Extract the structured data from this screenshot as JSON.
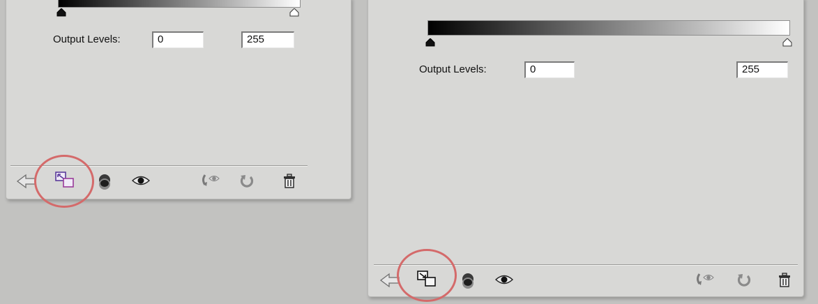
{
  "colors": {
    "background": "#c2c2c0",
    "panel": "#d8d8d6",
    "highlight": "#d46a6a",
    "accent_purple": "#6a3fa8"
  },
  "left_panel": {
    "output_levels_label": "Output Levels:",
    "output_min": "0",
    "output_max": "255",
    "toolbar": {
      "back_icon": "back-arrow-icon",
      "clip_icon": "clip-to-layer-icon",
      "prev_state_icon": "view-previous-state-icon",
      "visibility_icon": "eye-icon",
      "reset_icon": "reset-to-defaults-icon",
      "refresh_icon": "refresh-icon",
      "trash_icon": "trash-icon"
    }
  },
  "right_panel": {
    "output_levels_label": "Output Levels:",
    "output_min": "0",
    "output_max": "255",
    "toolbar": {
      "back_icon": "back-arrow-icon",
      "clip_icon": "clip-to-layer-icon",
      "prev_state_icon": "view-previous-state-icon",
      "visibility_icon": "eye-icon",
      "reset_icon": "reset-to-defaults-icon",
      "refresh_icon": "refresh-icon",
      "trash_icon": "trash-icon"
    }
  }
}
